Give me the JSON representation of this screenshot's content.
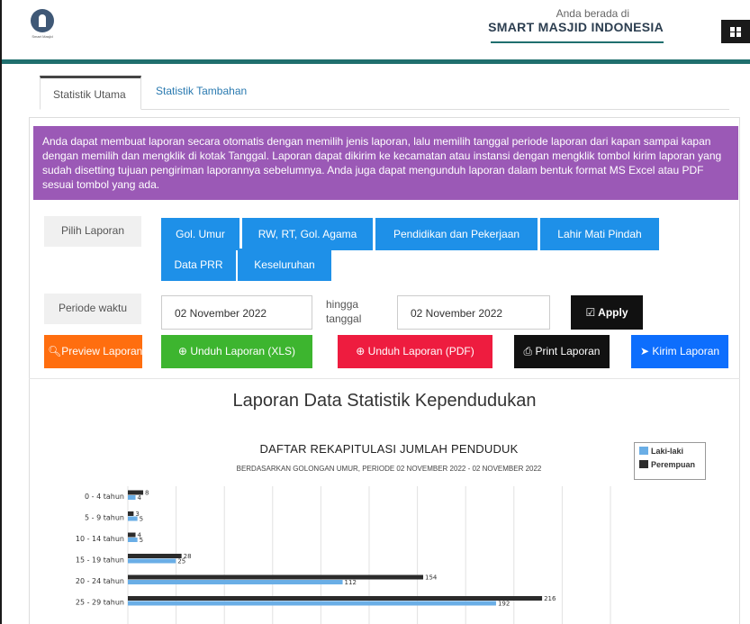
{
  "header": {
    "logo_text": "Smart Masjid",
    "location_prefix": "Anda berada di",
    "location_name": "SMART MASJID INDONESIA"
  },
  "tabs": [
    {
      "label": "Statistik Utama",
      "active": true
    },
    {
      "label": "Statistik Tambahan",
      "active": false
    }
  ],
  "info_text": "Anda dapat membuat laporan secara otomatis dengan memilih jenis laporan, lalu memilih tanggal periode laporan dari kapan sampai kapan dengan memilih dan mengklik di kotak Tanggal. Laporan dapat dikirim ke kecamatan atau instansi dengan mengklik tombol kirim laporan yang sudah disetting tujuan pengiriman laporannya sebelumnya. Anda juga dapat mengunduh laporan dalam bentuk format MS Excel atau PDF sesuai tombol yang ada.",
  "report_select": {
    "label": "Pilih Laporan",
    "options": [
      "Gol. Umur",
      "RW, RT, Gol. Agama",
      "Pendidikan dan Pekerjaan",
      "Lahir Mati Pindah",
      "Data PRR",
      "Keseluruhan"
    ]
  },
  "period": {
    "label": "Periode waktu",
    "start_date": "02 November 2022",
    "separator_line1": "hingga",
    "separator_line2": "tanggal",
    "end_date": "02 November 2022",
    "apply_label": "Apply"
  },
  "actions": {
    "preview": "Preview Laporan",
    "download_xls": "Unduh Laporan (XLS)",
    "download_pdf": "Unduh Laporan (PDF)",
    "print": "Print Laporan",
    "send": "Kirim Laporan"
  },
  "report_title": "Laporan Data Statistik Kependudukan",
  "colors": {
    "laki": "#6aaee6",
    "perempuan": "#2b2b2b",
    "info_bg": "#9b59b6",
    "header_accent": "#1f6f6e"
  },
  "chart_data": {
    "type": "bar",
    "orientation": "horizontal",
    "title": "DAFTAR REKAPITULASI JUMLAH PENDUDUK",
    "subtitle": "BERDASARKAN GOLONGAN UMUR, PERIODE 02 NOVEMBER 2022 - 02 NOVEMBER 2022",
    "legend_position": "top-right",
    "grid": true,
    "categories": [
      "0 - 4 tahun",
      "5 - 9 tahun",
      "10 - 14 tahun",
      "15 - 19 tahun",
      "20 - 24 tahun",
      "25 - 29 tahun"
    ],
    "series": [
      {
        "name": "Perempuan",
        "values": [
          8,
          3,
          4,
          28,
          154,
          216
        ]
      },
      {
        "name": "Laki-laki",
        "values": [
          4,
          5,
          5,
          25,
          112,
          192
        ]
      }
    ]
  }
}
